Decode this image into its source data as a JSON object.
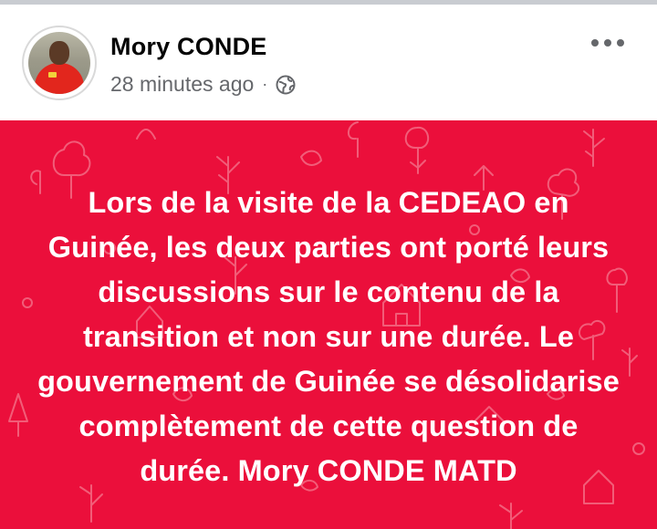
{
  "post": {
    "author": {
      "name": "Mory CONDE",
      "avatar_icon": "profile-photo"
    },
    "timestamp": "28 minutes ago",
    "separator": "·",
    "privacy_icon": "globe-icon",
    "menu_icon": "more-options-icon",
    "body": {
      "background_color": "#eb0f3b",
      "text_color": "#ffffff",
      "text": "Lors de la visite de la CEDEAO en Guinée, les deux parties ont porté leurs discussions sur le contenu de la transition et non sur une durée. Le gouvernement de Guinée se désolidarise complètement de cette question de durée. Mory CONDE MATD"
    }
  }
}
